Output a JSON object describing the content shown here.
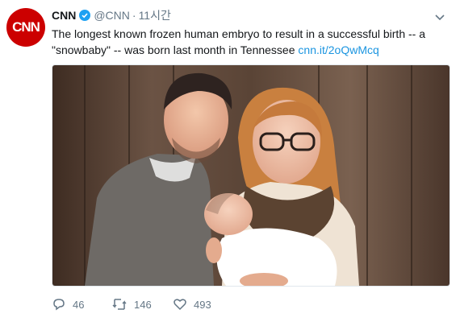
{
  "tweet": {
    "avatar_text": "CNN",
    "author_name": "CNN",
    "handle": "@CNN",
    "separator": "·",
    "time": "11시간",
    "text_main": "The longest known frozen human embryo to result in a successful birth -- a \"snowbaby\" -- was born last month in Tennessee",
    "link_text": "cnn.it/2oQwMcq",
    "actions": {
      "replies": "46",
      "retweets": "146",
      "likes": "493"
    }
  },
  "colors": {
    "cnn_red": "#cc0000",
    "verified_blue": "#1da1f2",
    "link_blue": "#1b95e0",
    "muted_gray": "#657786"
  },
  "icons": [
    "verified-badge-icon",
    "chevron-down-icon",
    "reply-icon",
    "retweet-icon",
    "like-icon"
  ]
}
